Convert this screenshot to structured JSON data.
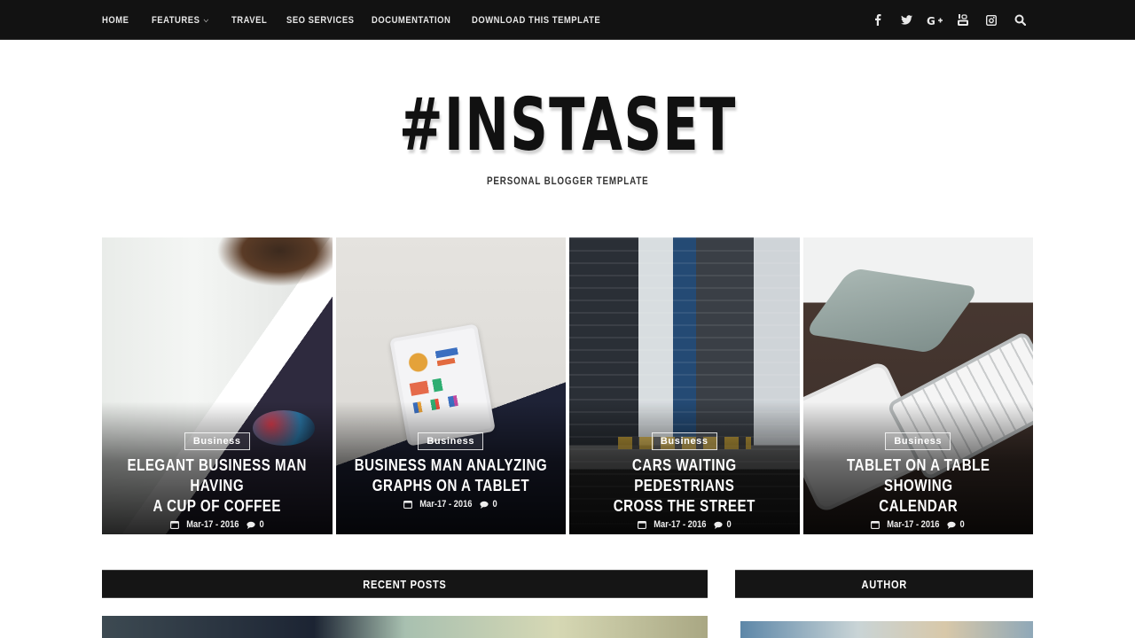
{
  "nav": {
    "items": [
      {
        "label": "HOME"
      },
      {
        "label": "FEATURES",
        "has_dropdown": true
      },
      {
        "label": "TRAVEL"
      },
      {
        "label": "SEO SERVICES"
      },
      {
        "label": "DOCUMENTATION"
      },
      {
        "label": "DOWNLOAD THIS TEMPLATE"
      }
    ],
    "dropdown_glyph": "⌄",
    "social": [
      {
        "name": "facebook-icon",
        "glyph": "f"
      },
      {
        "name": "twitter-icon",
        "glyph": "twitter"
      },
      {
        "name": "google-plus-icon",
        "glyph": "G+"
      },
      {
        "name": "youtube-icon",
        "glyph": "youtube"
      },
      {
        "name": "instagram-icon",
        "glyph": "instagram"
      },
      {
        "name": "search-icon",
        "glyph": "search"
      }
    ]
  },
  "brand": {
    "title": "#INSTASET",
    "tagline": "PERSONAL BLOGGER TEMPLATE"
  },
  "featured": [
    {
      "category": "Business",
      "title": "ELEGANT BUSINESS MAN HAVING\nA CUP OF COFFEE",
      "date": "Mar-17 - 2016",
      "comments": "0"
    },
    {
      "category": "Business",
      "title": "BUSINESS MAN ANALYZING\nGRAPHS ON A TABLET",
      "date": "Mar-17 - 2016",
      "comments": "0"
    },
    {
      "category": "Business",
      "title": "CARS WAITING PEDESTRIANS\nCROSS THE STREET",
      "date": "Mar-17 - 2016",
      "comments": "0"
    },
    {
      "category": "Business",
      "title": "TABLET ON A TABLE SHOWING\nCALENDAR",
      "date": "Mar-17 - 2016",
      "comments": "0"
    }
  ],
  "sections": {
    "recent_posts": "RECENT POSTS",
    "author": "AUTHOR"
  },
  "colors": {
    "topbar_bg": "#121212",
    "section_bar_bg": "#151515",
    "text_dark": "#111111"
  }
}
